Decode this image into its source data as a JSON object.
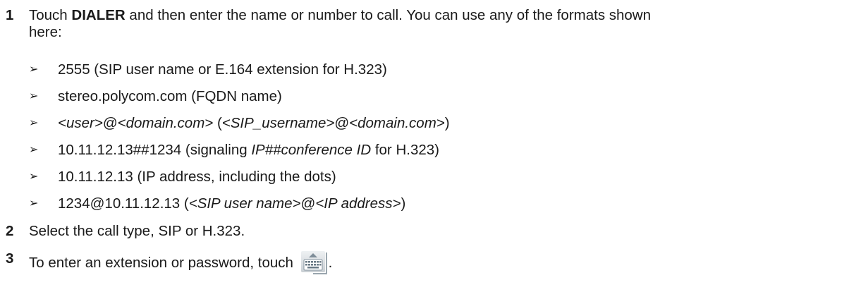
{
  "steps": [
    {
      "number": "1",
      "text_before": "Touch ",
      "bold": "DIALER",
      "text_after": " and then enter the name or number to call. You can use any of the formats shown",
      "text_line2": "here:"
    },
    {
      "number": "2",
      "text": "Select the call type, SIP or H.323."
    },
    {
      "number": "3",
      "text": "To enter an extension or password, touch ",
      "text_end": "."
    }
  ],
  "formats": {
    "arrow_glyph": "➢",
    "b1": "2555 (SIP user name or E.164 extension for H.323)",
    "b2": "stereo.polycom.com (FQDN name)",
    "b3_i1": "<user>",
    "b3_t1": "@",
    "b3_i2": "<domain.com>",
    "b3_t2": " (",
    "b3_i3": "<SIP_username>",
    "b3_t3": "@",
    "b3_i4": "<domain.com>",
    "b3_t4": ")",
    "b4_t1": "10.11.12.13##1234 (signaling ",
    "b4_i1": "IP##conference ID",
    "b4_t2": " for H.323)",
    "b5": "10.11.12.13 (IP address, including the dots)",
    "b6_t1": "1234@10.11.12.13 (",
    "b6_i1": "<SIP user name>",
    "b6_t2": "@",
    "b6_i2": "<IP address>",
    "b6_t3": ")"
  },
  "icons": {
    "keyboard": "keyboard-icon"
  },
  "colors": {
    "text": "#1a1a1a",
    "icon_bg": "#dfe3e6",
    "icon_key": "#6a7a86"
  }
}
